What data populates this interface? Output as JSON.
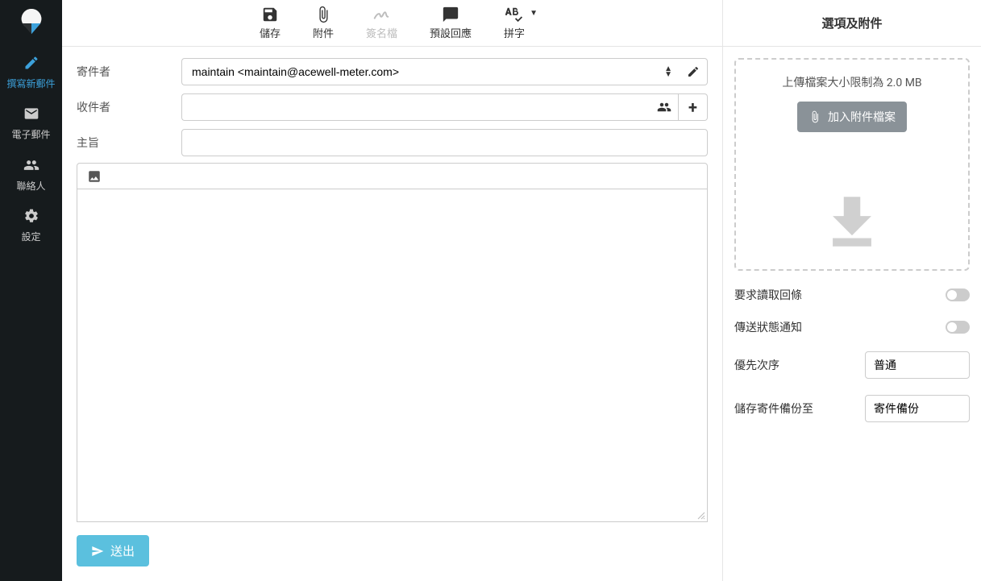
{
  "sidebar": {
    "items": [
      {
        "label": "撰寫新郵件",
        "icon": "compose-icon"
      },
      {
        "label": "電子郵件",
        "icon": "mail-icon"
      },
      {
        "label": "聯絡人",
        "icon": "contacts-icon"
      },
      {
        "label": "設定",
        "icon": "settings-icon"
      }
    ]
  },
  "toolbar": {
    "save": "儲存",
    "attach": "附件",
    "signature": "簽名檔",
    "responses": "預設回應",
    "spell": "拼字"
  },
  "form": {
    "from_label": "寄件者",
    "from_value": "maintain <maintain@acewell-meter.com>",
    "to_label": "收件者",
    "to_value": "",
    "subject_label": "主旨",
    "subject_value": ""
  },
  "send_label": "送出",
  "right": {
    "title": "選項及附件",
    "upload_hint": "上傳檔案大小限制為 2.0 MB",
    "attach_button": "加入附件檔案",
    "opt_receipt": "要求讀取回條",
    "opt_dsn": "傳送狀態通知",
    "opt_priority": "優先次序",
    "priority_value": "普通",
    "opt_savecopy": "儲存寄件備份至",
    "savecopy_value": "寄件備份"
  }
}
